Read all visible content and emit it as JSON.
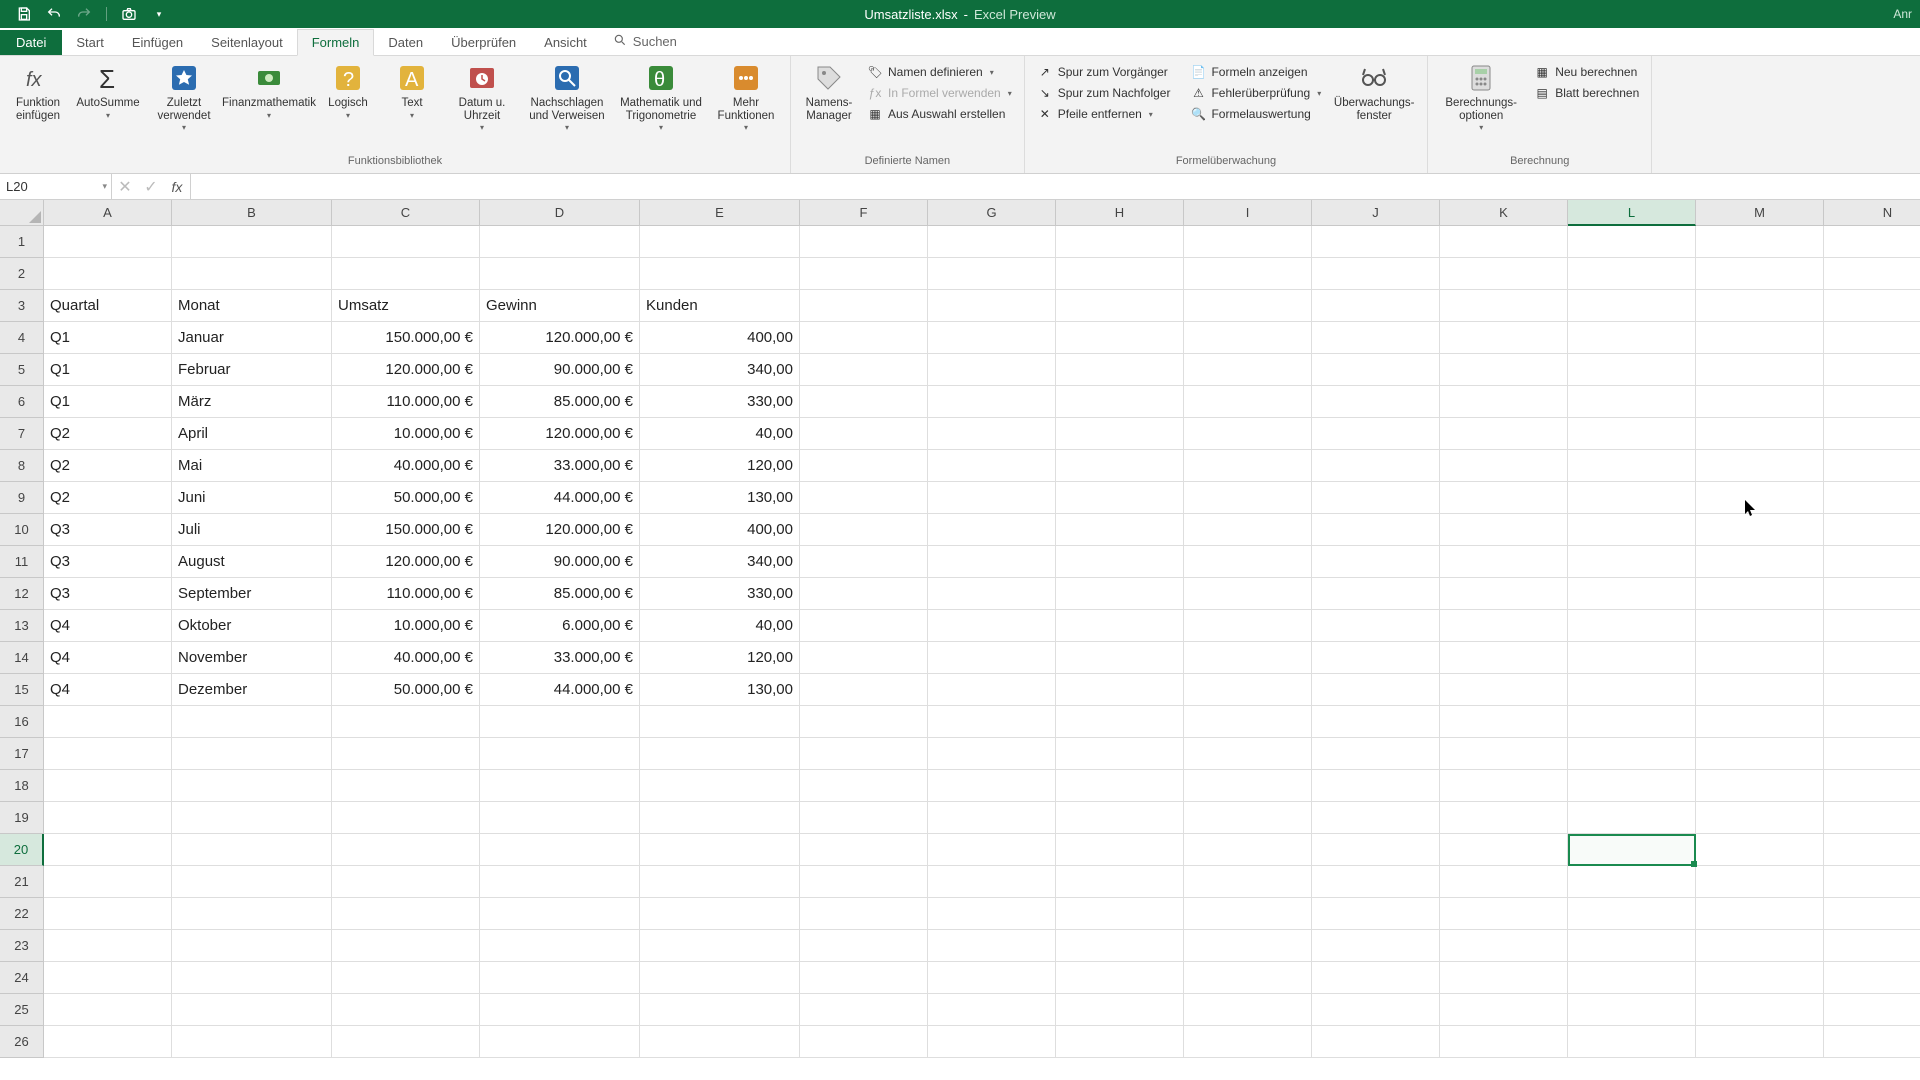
{
  "titlebar": {
    "filename": "Umsatzliste.xlsx",
    "app": "Excel Preview",
    "right": "Anr"
  },
  "tabs": {
    "file": "Datei",
    "items": [
      "Start",
      "Einfügen",
      "Seitenlayout",
      "Formeln",
      "Daten",
      "Überprüfen",
      "Ansicht"
    ],
    "active_index": 3,
    "search": "Suchen"
  },
  "ribbon": {
    "func_lib": {
      "insert_fn": "Funktion einfügen",
      "autosum": "AutoSumme",
      "recent": "Zuletzt verwendet",
      "financial": "Finanzmathematik",
      "logical": "Logisch",
      "text": "Text",
      "date": "Datum u. Uhrzeit",
      "lookup": "Nachschlagen und Verweisen",
      "math": "Mathematik und Trigonometrie",
      "more": "Mehr Funktionen",
      "label": "Funktionsbibliothek"
    },
    "names": {
      "name_mgr": "Namens-Manager",
      "define": "Namen definieren",
      "use_in_formula": "In Formel verwenden",
      "from_selection": "Aus Auswahl erstellen",
      "label": "Definierte Namen"
    },
    "auditing": {
      "trace_prec": "Spur zum Vorgänger",
      "trace_dep": "Spur zum Nachfolger",
      "remove_arrows": "Pfeile entfernen",
      "show_formulas": "Formeln anzeigen",
      "error_check": "Fehlerüberprüfung",
      "evaluate": "Formelauswertung",
      "watch": "Überwachungs-fenster",
      "label": "Formelüberwachung"
    },
    "calc": {
      "options": "Berechnungs-optionen",
      "calc_now": "Neu berechnen",
      "calc_sheet": "Blatt berechnen",
      "label": "Berechnung"
    }
  },
  "fbar": {
    "namebox": "L20",
    "formula": ""
  },
  "grid": {
    "col_widths": {
      "A": 128,
      "B": 160,
      "C": 148,
      "D": 160,
      "E": 160,
      "F": 128,
      "G": 128,
      "H": 128,
      "I": 128,
      "J": 128,
      "K": 128,
      "L": 128,
      "M": 128,
      "N": 128
    },
    "columns": [
      "A",
      "B",
      "C",
      "D",
      "E",
      "F",
      "G",
      "H",
      "I",
      "J",
      "K",
      "L",
      "M",
      "N"
    ],
    "row_count": 26,
    "active_col": "L",
    "active_row": 20,
    "headers_row": 3,
    "headers": {
      "A": "Quartal",
      "B": "Monat",
      "C": "Umsatz",
      "D": "Gewinn",
      "E": "Kunden"
    },
    "data": [
      {
        "A": "Q1",
        "B": "Januar",
        "C": "150.000,00 €",
        "D": "120.000,00 €",
        "E": "400,00"
      },
      {
        "A": "Q1",
        "B": "Februar",
        "C": "120.000,00 €",
        "D": "90.000,00 €",
        "E": "340,00"
      },
      {
        "A": "Q1",
        "B": "März",
        "C": "110.000,00 €",
        "D": "85.000,00 €",
        "E": "330,00"
      },
      {
        "A": "Q2",
        "B": "April",
        "C": "10.000,00 €",
        "D": "120.000,00 €",
        "E": "40,00"
      },
      {
        "A": "Q2",
        "B": "Mai",
        "C": "40.000,00 €",
        "D": "33.000,00 €",
        "E": "120,00"
      },
      {
        "A": "Q2",
        "B": "Juni",
        "C": "50.000,00 €",
        "D": "44.000,00 €",
        "E": "130,00"
      },
      {
        "A": "Q3",
        "B": "Juli",
        "C": "150.000,00 €",
        "D": "120.000,00 €",
        "E": "400,00"
      },
      {
        "A": "Q3",
        "B": "August",
        "C": "120.000,00 €",
        "D": "90.000,00 €",
        "E": "340,00"
      },
      {
        "A": "Q3",
        "B": "September",
        "C": "110.000,00 €",
        "D": "85.000,00 €",
        "E": "330,00"
      },
      {
        "A": "Q4",
        "B": "Oktober",
        "C": "10.000,00 €",
        "D": "6.000,00 €",
        "E": "40,00"
      },
      {
        "A": "Q4",
        "B": "November",
        "C": "40.000,00 €",
        "D": "33.000,00 €",
        "E": "120,00"
      },
      {
        "A": "Q4",
        "B": "Dezember",
        "C": "50.000,00 €",
        "D": "44.000,00 €",
        "E": "130,00"
      }
    ]
  },
  "colors": {
    "excel_green": "#0e6e3d",
    "selection": "#1a8a4f"
  }
}
